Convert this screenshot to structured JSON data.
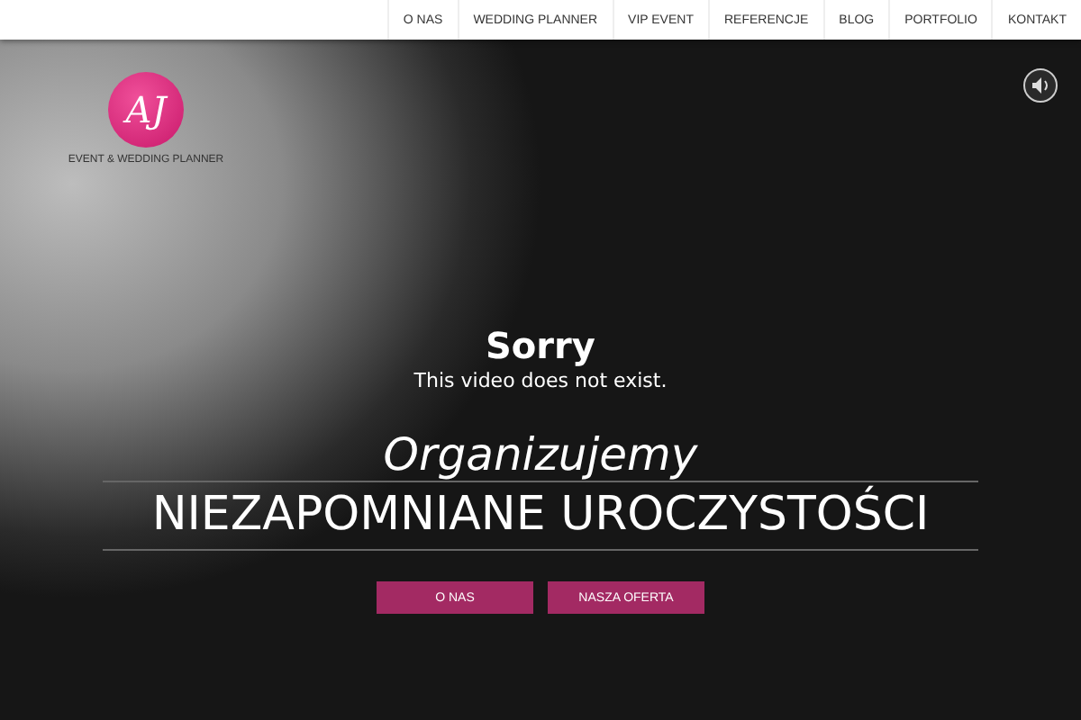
{
  "nav": {
    "items": [
      "O NAS",
      "WEDDING PLANNER",
      "VIP EVENT",
      "REFERENCJE",
      "BLOG",
      "PORTFOLIO",
      "KONTAKT"
    ]
  },
  "logo": {
    "monogram": "AJ",
    "tagline": "EVENT & WEDDING PLANNER"
  },
  "video_error": {
    "title": "Sorry",
    "message": "This video does not exist."
  },
  "hero": {
    "kicker": "Organizujemy",
    "headline": "NIEZAPOMNIANE UROCZYSTOŚCI",
    "buttons": [
      "O NAS",
      "NASZA OFERTA"
    ]
  }
}
